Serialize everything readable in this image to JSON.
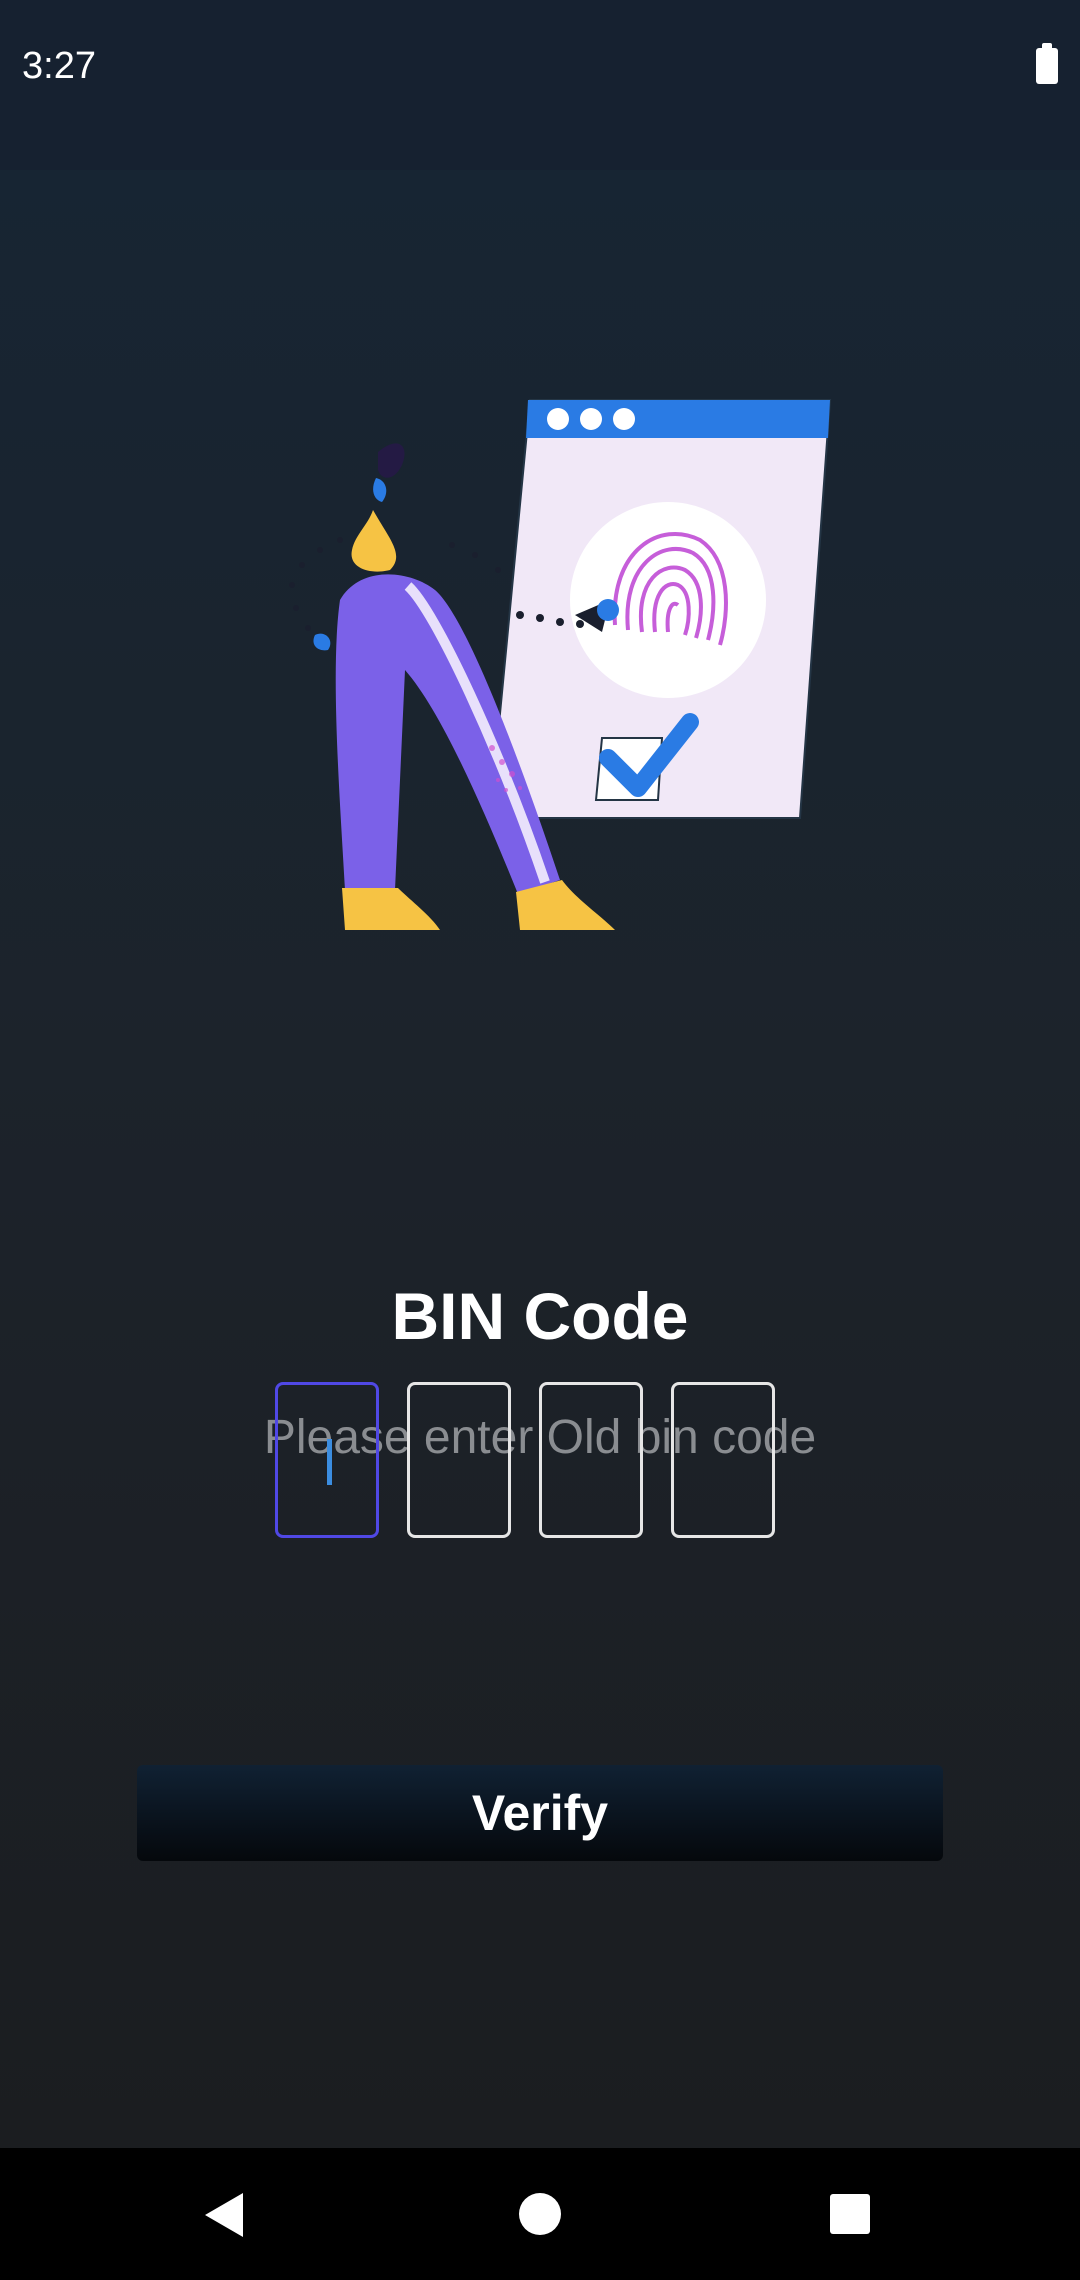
{
  "status_bar": {
    "time": "3:27",
    "battery_icon": "battery-full-icon"
  },
  "main": {
    "illustration_icon": "fingerprint-verification-illustration",
    "title": "BIN Code",
    "subtitle": "Please enter Old bin code",
    "pin_boxes": [
      "",
      "",
      "",
      ""
    ],
    "active_pin_index": 0,
    "verify_label": "Verify"
  },
  "nav_bar": {
    "back_icon": "back-triangle-icon",
    "home_icon": "home-circle-icon",
    "recents_icon": "recents-square-icon"
  },
  "colors": {
    "accent": "#5048e5",
    "cursor": "#3b8de0",
    "illustration_purple": "#7b61e8",
    "illustration_yellow": "#f6c344",
    "illustration_blue": "#2a7be4"
  }
}
